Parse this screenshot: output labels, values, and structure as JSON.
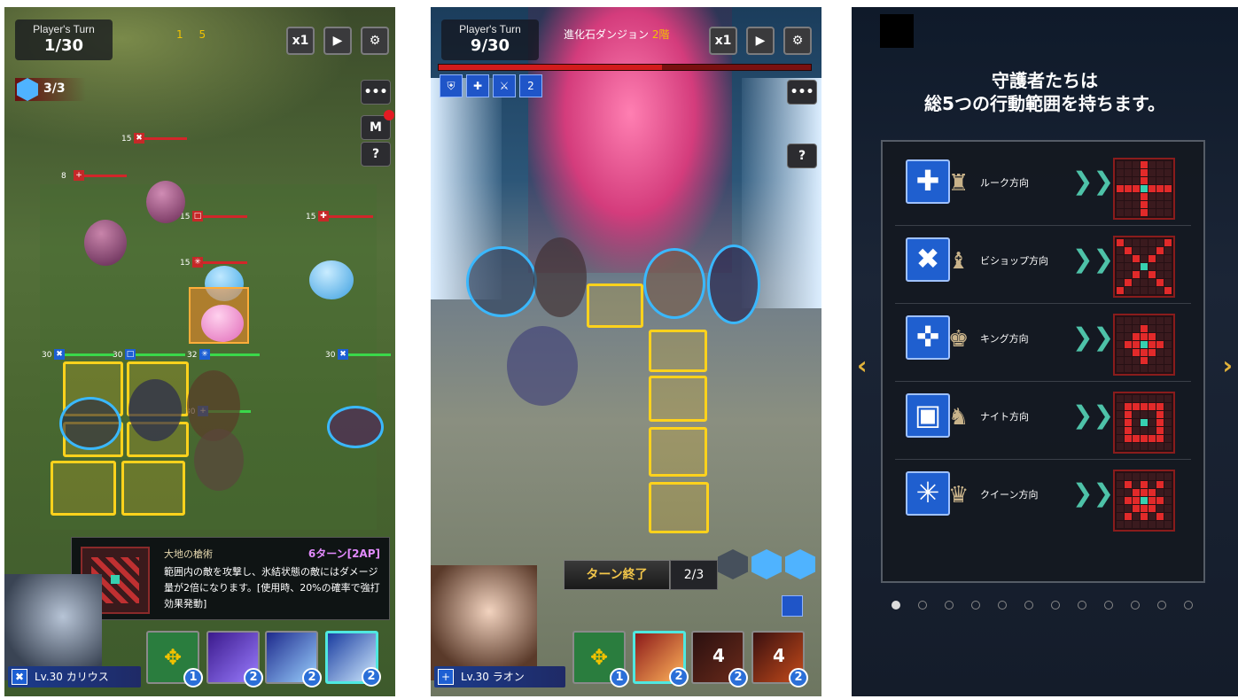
{
  "panel1": {
    "turn_label": "Player's Turn",
    "turn_value": "1/30",
    "speed_btn": "x1",
    "play_icon": "play-icon",
    "settings_icon": "gear-icon",
    "crystals": "3/3",
    "ap_top": "1",
    "ap_top_max": "5",
    "menu_btn": "•••",
    "m_btn": "M",
    "help_btn": "?",
    "hp_levels": [
      "15",
      "8",
      "15",
      "15",
      "15",
      "30",
      "30",
      "32",
      "30",
      "30"
    ],
    "tooltip": {
      "title": "大地の槍術",
      "cost": "6ターン[2AP]",
      "desc": "範囲内の敵を攻撃し、氷結状態の敵にはダメージ量が2倍になります。[使用時、20%の確率で強打効果発動]"
    },
    "skills": [
      {
        "cost": "1"
      },
      {
        "cost": "2"
      },
      {
        "cost": "2"
      },
      {
        "cost": "2"
      }
    ],
    "char": "Lv.30 カリウス"
  },
  "panel2": {
    "turn_label": "Player's Turn",
    "turn_value": "9/30",
    "dungeon": "進化石ダンジョン",
    "floor": "2階",
    "speed_btn": "x1",
    "menu_btn": "•••",
    "help_btn": "?",
    "buff_stack": "2",
    "boss_hp_fraction": 0.6,
    "end_turn": "ターン終了",
    "ap_count": "2/3",
    "skills": [
      {
        "cost": "1",
        "cd": ""
      },
      {
        "cost": "2",
        "cd": ""
      },
      {
        "cost": "2",
        "cd": "4"
      },
      {
        "cost": "2",
        "cd": "4"
      }
    ],
    "char": "Lv.30 ラオン"
  },
  "panel3": {
    "title_line1": "守護者たちは",
    "title_line2": "総5つの行動範囲を持ちます。",
    "rows": [
      {
        "name": "ルーク方向",
        "glyph": "✚",
        "piece": "♜"
      },
      {
        "name": "ビショップ方向",
        "glyph": "✖",
        "piece": "♝"
      },
      {
        "name": "キング方向",
        "glyph": "✜",
        "piece": "♚"
      },
      {
        "name": "ナイト方向",
        "glyph": "▣",
        "piece": "♞"
      },
      {
        "name": "クイーン方向",
        "glyph": "✳",
        "piece": "♛"
      }
    ],
    "arrows": "❯❯",
    "left_arrow": "‹",
    "right_arrow": "›",
    "page_count": 12,
    "page_current": 1
  },
  "colors": {
    "accent_gold": "#ffd21c",
    "chip_blue": "#1f5fcf",
    "danger_red": "#d21c1c"
  }
}
